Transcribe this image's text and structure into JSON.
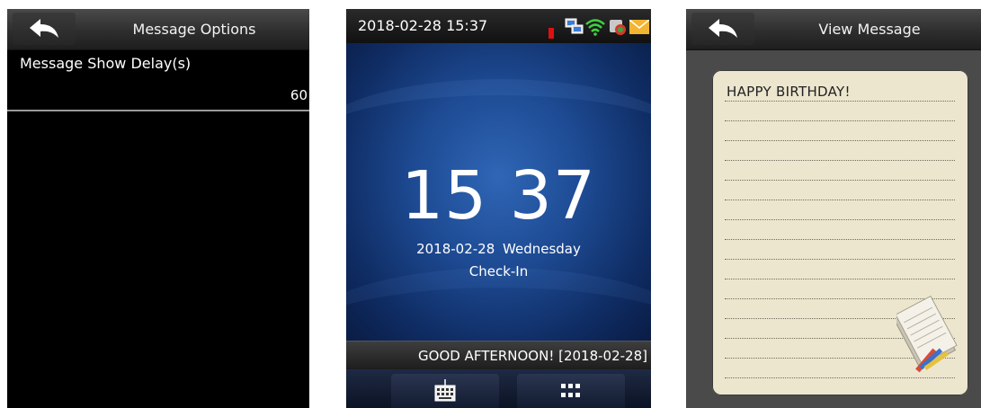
{
  "message_options": {
    "title": "Message Options",
    "option_label": "Message Show Delay(s)",
    "option_value": "60"
  },
  "home": {
    "status_time": "2018-02-28 15:37",
    "clock": "15 37",
    "date_line": "2018-02-28  Wednesday",
    "state": "Check-In",
    "ticker": "GOOD AFTERNOON! [2018-02-28]",
    "status_icons": [
      "alert-icon",
      "network-icon",
      "wifi-icon",
      "server-icon",
      "message-icon"
    ],
    "bottom_buttons": [
      "keyboard-icon",
      "menu-grid-icon"
    ]
  },
  "view_message": {
    "title": "View Message",
    "message_text": "HAPPY BIRTHDAY!"
  },
  "colors": {
    "alert": "#e01010",
    "wifi": "#3fd23f",
    "message": "#f2b531",
    "paper": "#ede6cf"
  }
}
